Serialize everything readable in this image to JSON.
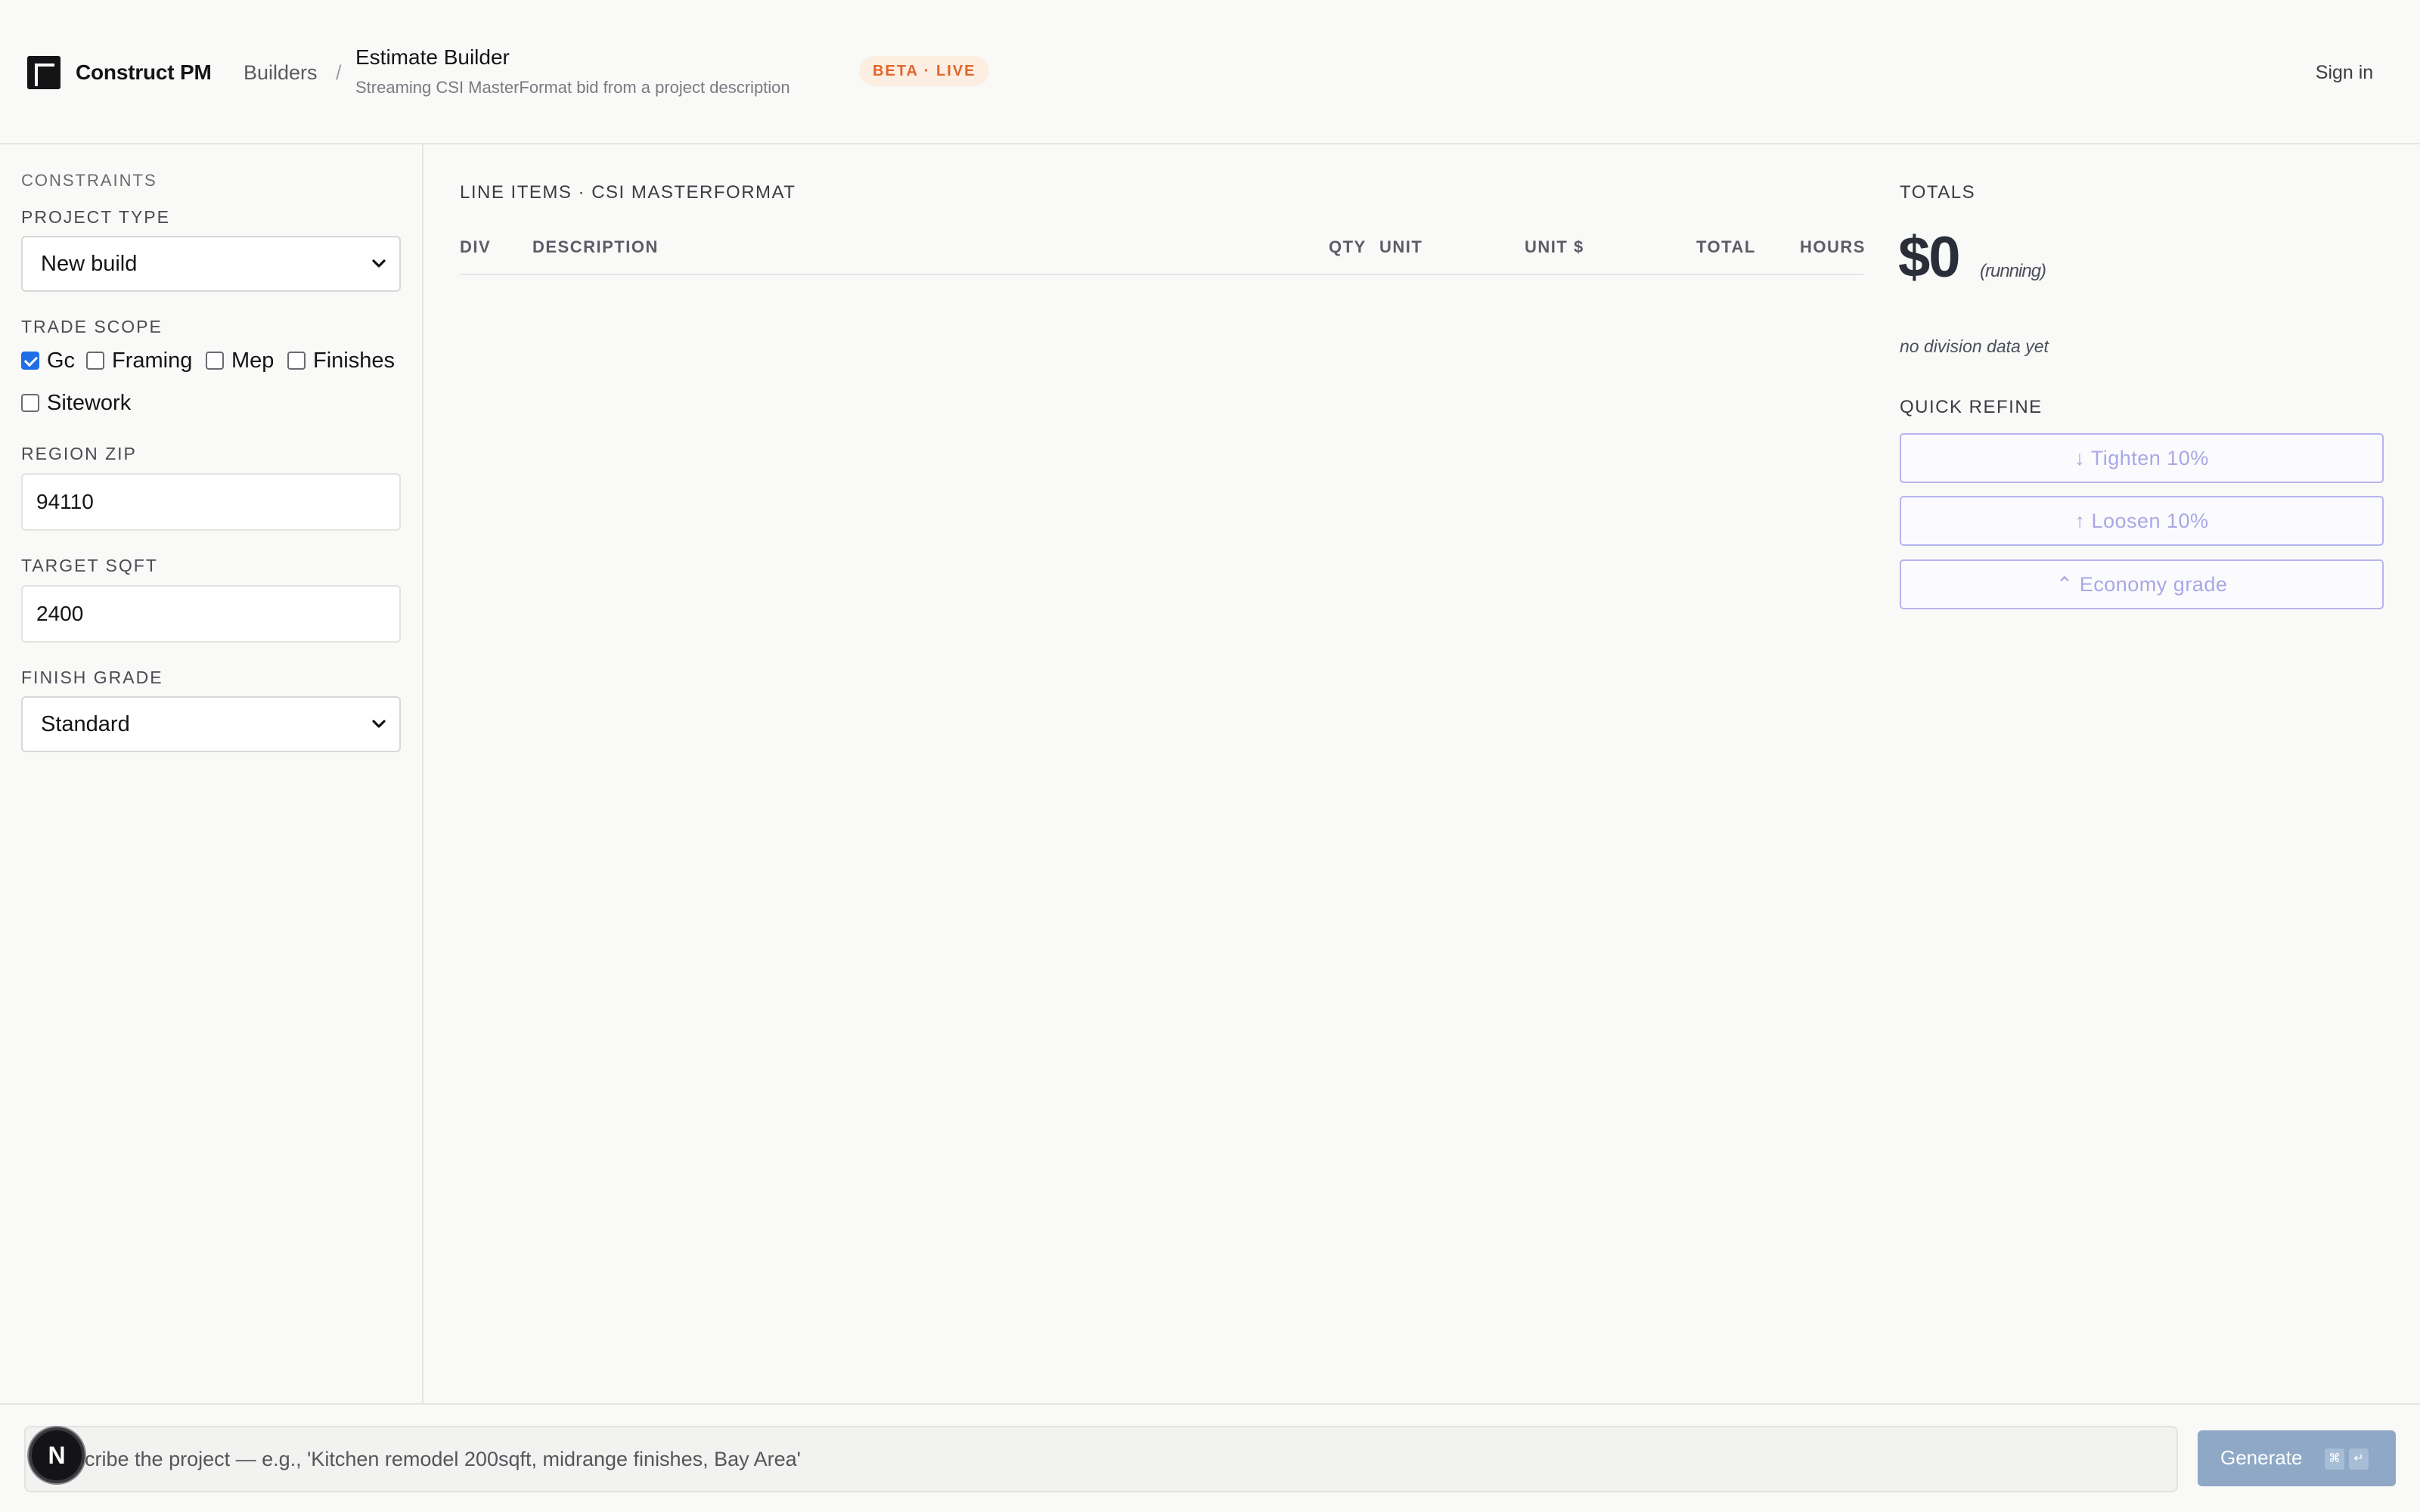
{
  "header": {
    "brand": "Construct PM",
    "breadcrumb_root": "Builders",
    "breadcrumb_sep": "/",
    "title": "Estimate Builder",
    "subtitle": "Streaming CSI MasterFormat bid from a project description",
    "badge": "BETA · LIVE",
    "sign_in": "Sign in"
  },
  "sidebar": {
    "section": "CONSTRAINTS",
    "project_type": {
      "label": "PROJECT TYPE",
      "value": "New build"
    },
    "trade_scope": {
      "label": "TRADE SCOPE",
      "options": [
        {
          "label": "Gc",
          "checked": true
        },
        {
          "label": "Framing",
          "checked": false
        },
        {
          "label": "Mep",
          "checked": false
        },
        {
          "label": "Finishes",
          "checked": false
        },
        {
          "label": "Sitework",
          "checked": false
        }
      ]
    },
    "region_zip": {
      "label": "REGION ZIP",
      "value": "94110"
    },
    "target_sqft": {
      "label": "TARGET SQFT",
      "value": "2400"
    },
    "finish_grade": {
      "label": "FINISH GRADE",
      "value": "Standard"
    }
  },
  "table": {
    "heading": "LINE ITEMS · CSI MASTERFORMAT",
    "columns": [
      "DIV",
      "DESCRIPTION",
      "QTY",
      "UNIT",
      "UNIT $",
      "TOTAL",
      "HOURS"
    ],
    "rows": []
  },
  "totals": {
    "label": "TOTALS",
    "amount": "$0",
    "note": "(running)",
    "division_empty": "no division data yet",
    "refine_label": "QUICK REFINE",
    "refine_buttons": [
      "↓ Tighten 10%",
      "↑ Loosen 10%",
      "⌃ Economy grade"
    ]
  },
  "composer": {
    "placeholder": "Describe the project — e.g., 'Kitchen remodel 200sqft, midrange finishes, Bay Area'",
    "avatar_initial": "N",
    "generate_label": "Generate",
    "shortcut_keys": [
      "⌘",
      "↵"
    ]
  },
  "colors": {
    "accent_checkbox": "#1f6ee8",
    "badge_text": "#e0652a",
    "badge_bg": "#fdeee2",
    "refine_border": "#b6b4ee",
    "generate_bg": "#8ea8c6"
  },
  "icons": {
    "logo": "construct-logo-icon",
    "select_chevron": "chevron-down-icon"
  }
}
